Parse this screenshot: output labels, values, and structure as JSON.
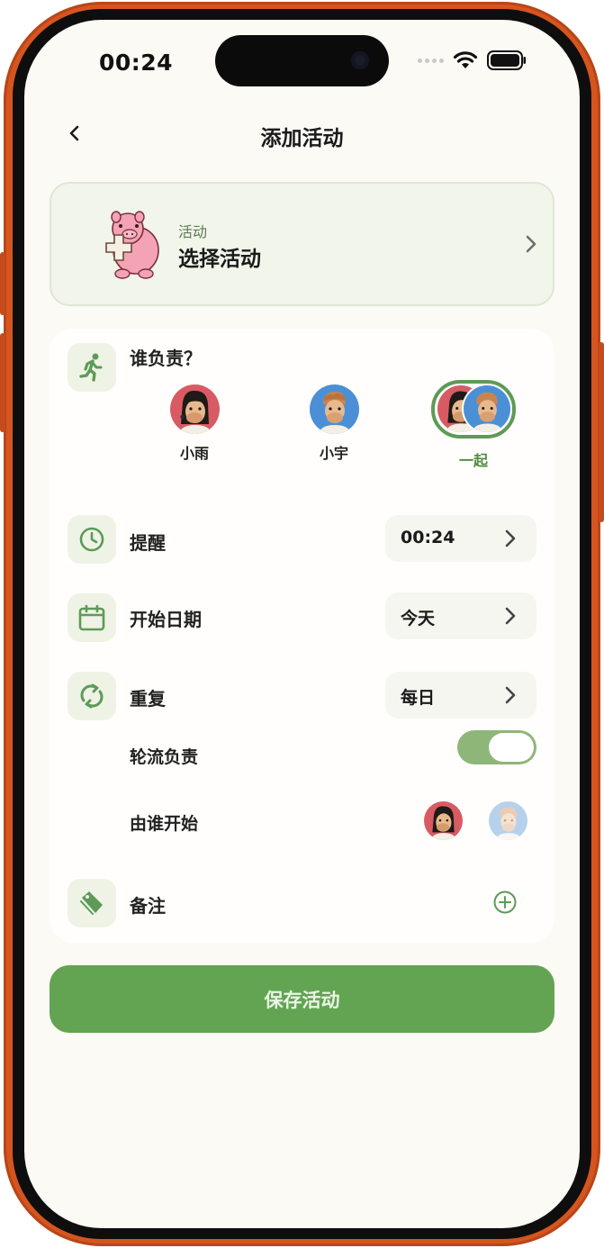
{
  "status_bar": {
    "time": "00:24"
  },
  "header": {
    "title": "添加活动"
  },
  "activity": {
    "label": "活动",
    "value": "选择活动"
  },
  "responsible": {
    "question": "谁负责？",
    "options": [
      {
        "name": "小雨",
        "selected": false
      },
      {
        "name": "小宇",
        "selected": false
      },
      {
        "name": "一起",
        "selected": true
      }
    ]
  },
  "reminder": {
    "label": "提醒",
    "value": "00:24"
  },
  "start_date": {
    "label": "开始日期",
    "value": "今天"
  },
  "repeat": {
    "label": "重复",
    "value": "每日"
  },
  "rotation": {
    "label": "轮流负责",
    "enabled": true
  },
  "who_starts": {
    "label": "由谁开始"
  },
  "notes": {
    "label": "备注"
  },
  "save_button": {
    "label": "保存活动"
  },
  "colors": {
    "frame": "#d6551f",
    "background": "#fcfaf4",
    "accent_green": "#62a452",
    "selected_name": "#4f8a3f",
    "icon_green": "#5e9a57"
  }
}
